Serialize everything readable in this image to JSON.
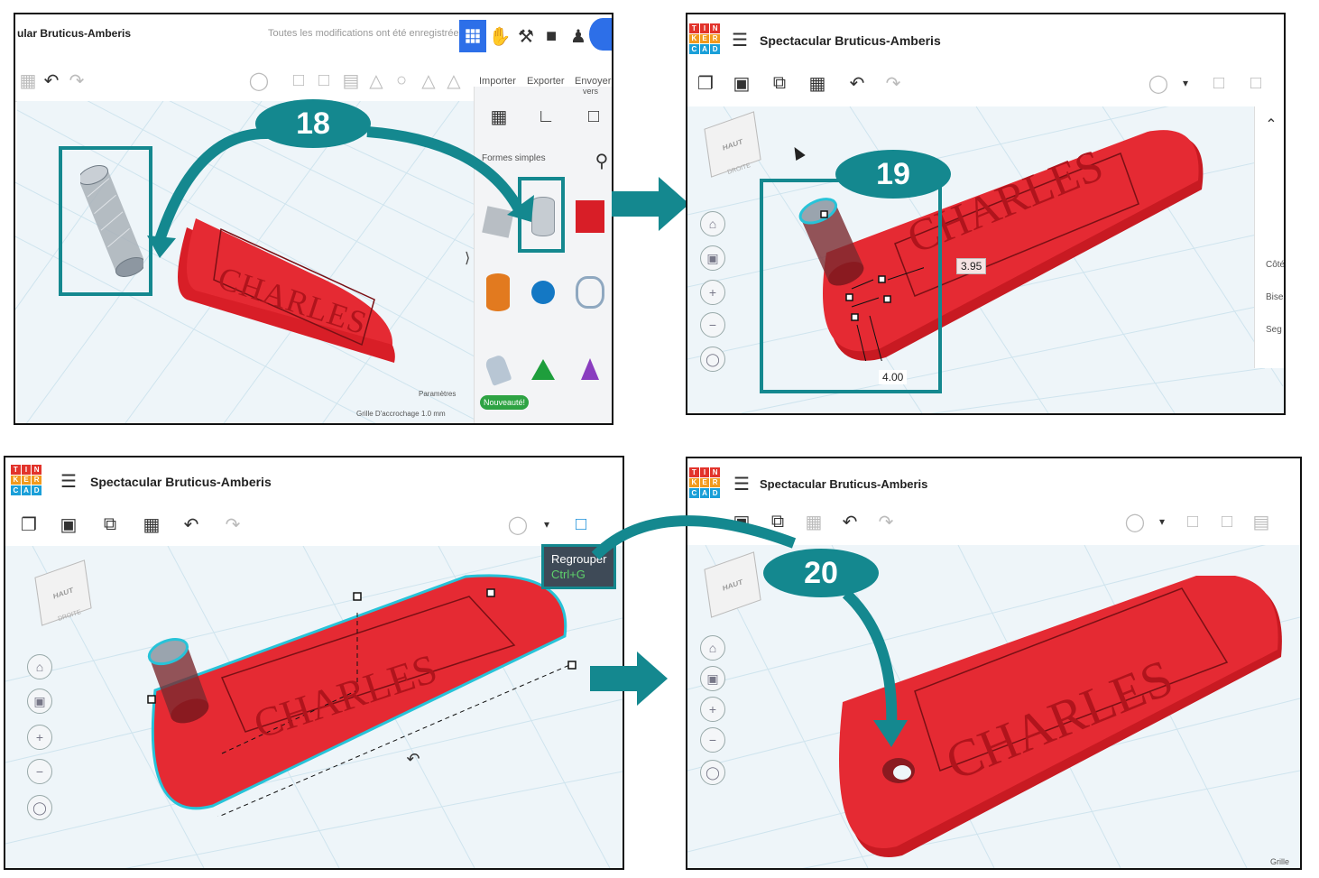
{
  "colors": {
    "accent": "#14888f",
    "model_red": "#e0232b",
    "grid": "#cfe4ee",
    "tooltip_bg": "#3e4a57",
    "shortcut": "#5fd16b"
  },
  "steps": {
    "s18": "18",
    "s19": "19",
    "s20": "20"
  },
  "panel1": {
    "title": "ular Bruticus-Amberis",
    "saved_status": "Toutes les modifications ont été enregistrées",
    "actions": {
      "import": "Importer",
      "export": "Exporter",
      "send": "Envoyer",
      "send2": "vers"
    },
    "shape_category": "Formes simples",
    "collapse_glyph": "⟩",
    "params_label": "Paramètres",
    "snap_label": "Grille D'accrochage",
    "snap_value": "1.0 mm",
    "new_badge": "Nouveauté!",
    "model_text": "CHARLES",
    "icons": [
      "grid-view-icon",
      "hand-icon",
      "pickaxe-icon",
      "brick-icon",
      "add-user-icon",
      "avatar"
    ]
  },
  "panel2": {
    "title": "Spectacular Bruticus-Amberis",
    "dim_width": "3.95",
    "dim_length": "4.00",
    "side_labels": [
      "Côté",
      "Bise",
      "Seg"
    ],
    "cube_top": "HAUT",
    "cube_side": "DROITE",
    "model_text": "CHARLES"
  },
  "panel3": {
    "title": "Spectacular Bruticus-Amberis",
    "tooltip_title": "Regrouper",
    "tooltip_shortcut": "Ctrl+G",
    "cube_top": "HAUT",
    "cube_side": "DROITE",
    "model_text": "CHARLES"
  },
  "panel4": {
    "title": "Spectacular Bruticus-Amberis",
    "cube_top": "HAUT",
    "grid_label": "Grille",
    "model_text": "CHARLES"
  },
  "logo_letters": [
    "T",
    "I",
    "N",
    "K",
    "E",
    "R",
    "C",
    "A",
    "D"
  ]
}
